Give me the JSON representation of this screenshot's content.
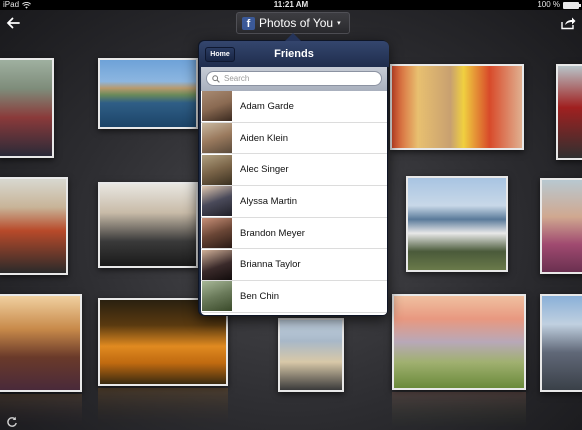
{
  "status_bar": {
    "device": "iPad",
    "time": "11:21 AM",
    "battery_percent": "100 %",
    "battery_level": 1.0
  },
  "nav": {
    "title": "Photos of You",
    "fb_letter": "f",
    "back_icon": "back-arrow-icon",
    "share_icon": "share-icon",
    "caret": "▾"
  },
  "popover": {
    "title": "Friends",
    "home_label": "Home",
    "search_placeholder": "Search",
    "friends": [
      {
        "name": "Adam Garde",
        "color": "#8a6a52"
      },
      {
        "name": "Aiden Klein",
        "color": "#9a7a5e"
      },
      {
        "name": "Alec Singer",
        "color": "#7a6448"
      },
      {
        "name": "Alyssa Martin",
        "color": "#4a4a5a"
      },
      {
        "name": "Brandon Meyer",
        "color": "#6a4636"
      },
      {
        "name": "Brianna Taylor",
        "color": "#3a2a2a"
      },
      {
        "name": "Ben Chin",
        "color": "#6a7a5a"
      }
    ]
  },
  "colors": {
    "popover_header": "#34466e",
    "facebook_blue": "#3b5998"
  }
}
